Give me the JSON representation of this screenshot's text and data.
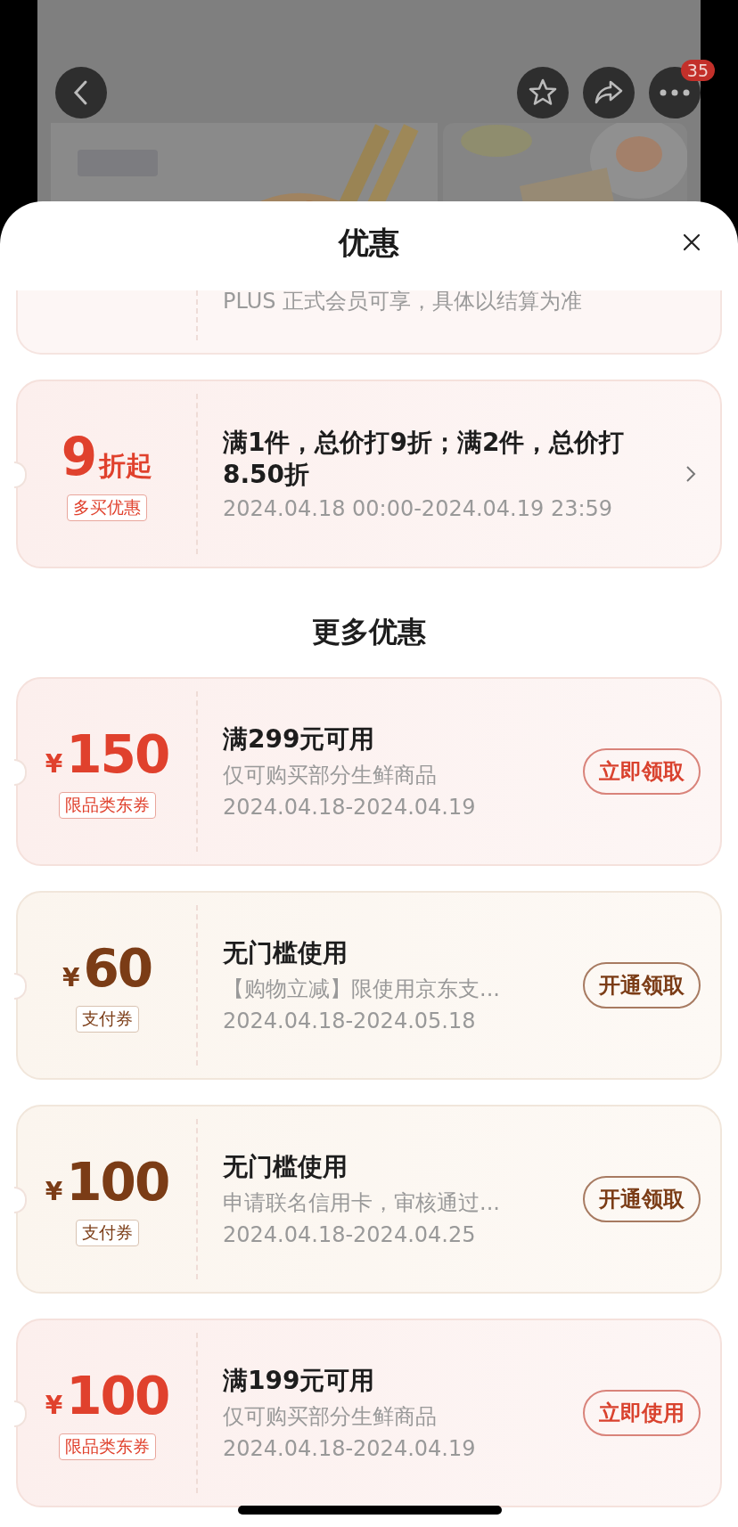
{
  "nav": {
    "badge": "35"
  },
  "sheet": {
    "title": "优惠"
  },
  "partial_coupon": {
    "text": "PLUS 正式会员可享，具体以结算为准"
  },
  "promo": {
    "value": "9",
    "unit": "折起",
    "tag": "多买优惠",
    "title": "满1件，总价打9折；满2件，总价打8.50折",
    "period": "2024.04.18 00:00-2024.04.19 23:59"
  },
  "section_title": "更多优惠",
  "coupons": [
    {
      "kind": "category",
      "currency": "¥",
      "amount": "150",
      "tag": "限品类东券",
      "condition": "满299元可用",
      "desc": "仅可购买部分生鲜商品",
      "period": "2024.04.18-2024.04.19",
      "action": "立即领取"
    },
    {
      "kind": "payment",
      "currency": "¥",
      "amount": "60",
      "tag": "支付券",
      "condition": "无门槛使用",
      "desc": "【购物立减】限使用京东支...",
      "period": "2024.04.18-2024.05.18",
      "action": "开通领取"
    },
    {
      "kind": "payment",
      "currency": "¥",
      "amount": "100",
      "tag": "支付券",
      "condition": "无门槛使用",
      "desc": "申请联名信用卡，审核通过...",
      "period": "2024.04.18-2024.04.25",
      "action": "开通领取"
    },
    {
      "kind": "category",
      "currency": "¥",
      "amount": "100",
      "tag": "限品类东券",
      "condition": "满199元可用",
      "desc": "仅可购买部分生鲜商品",
      "period": "2024.04.18-2024.04.19",
      "action": "立即使用"
    }
  ]
}
